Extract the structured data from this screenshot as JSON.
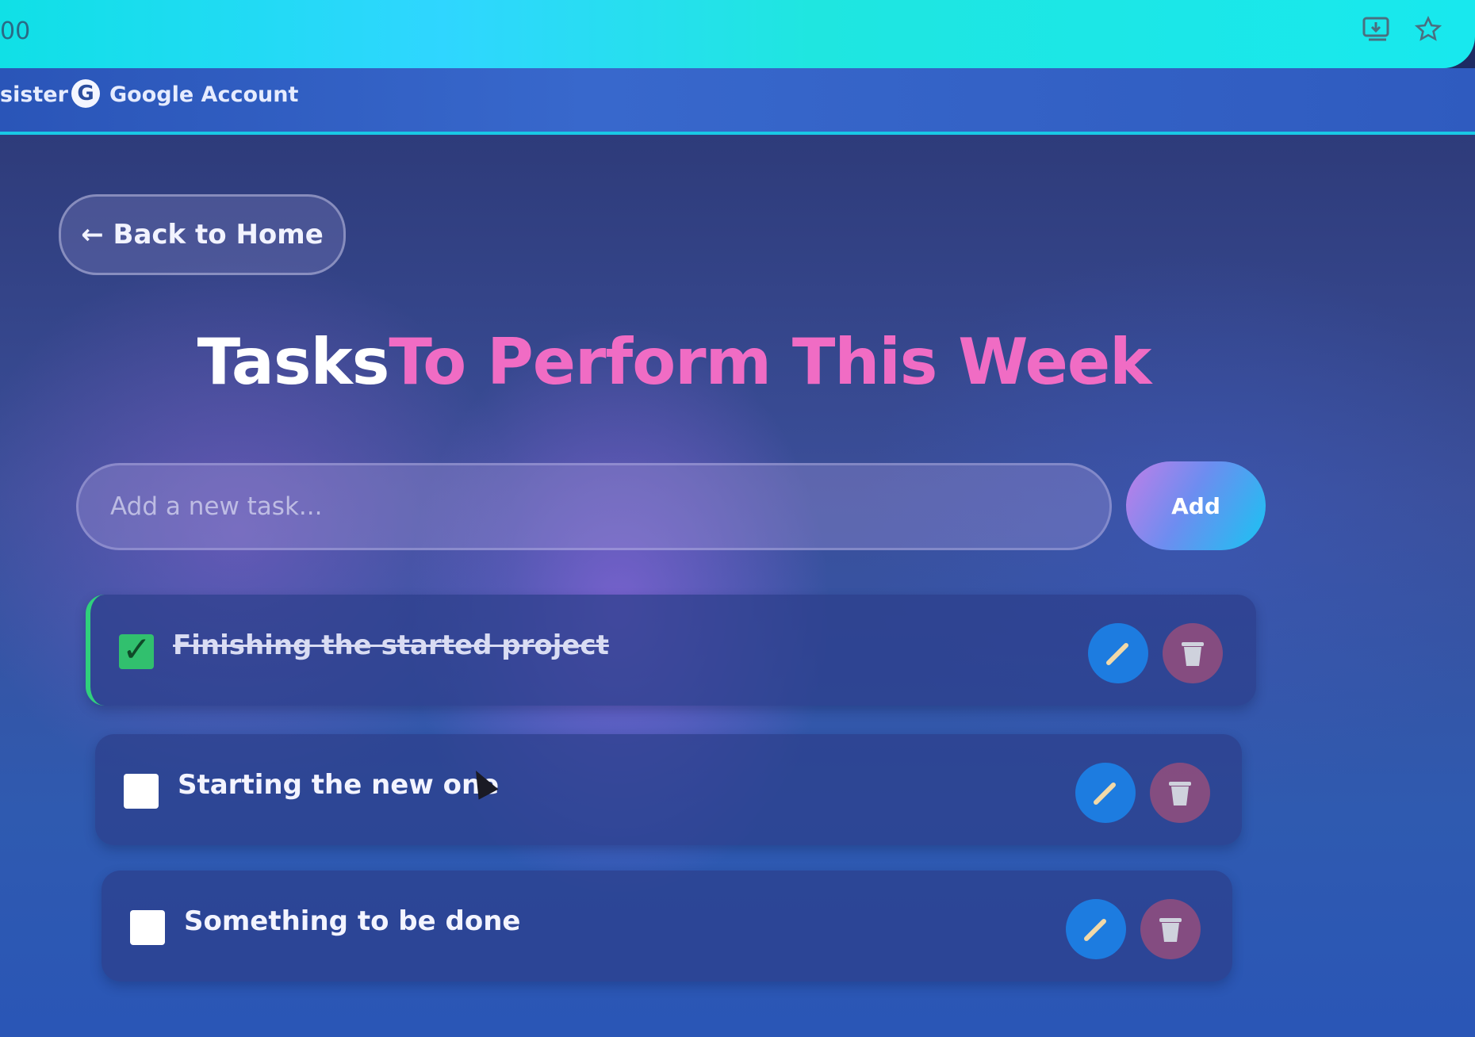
{
  "browser": {
    "url_fragment": "00",
    "bookmarks": [
      {
        "label": "sister"
      },
      {
        "label": "Google Account"
      }
    ],
    "icons": [
      "install-app-icon",
      "star-icon"
    ]
  },
  "page": {
    "back_label": "← Back to Home",
    "title_white": "Tasks",
    "title_pink": "To Perform This Week",
    "input": {
      "value": "",
      "placeholder": "Add a new task..."
    },
    "add_label": "Add",
    "tasks": [
      {
        "text": "Finishing the started project",
        "done": true
      },
      {
        "text": "Starting the new one",
        "done": false
      },
      {
        "text": "Something to be done",
        "done": false
      }
    ]
  },
  "colors": {
    "accent_pink": "#f06cc4",
    "done_green": "#31c06e",
    "edit_blue": "#1d7ce0",
    "delete_red": "#aa5078"
  }
}
